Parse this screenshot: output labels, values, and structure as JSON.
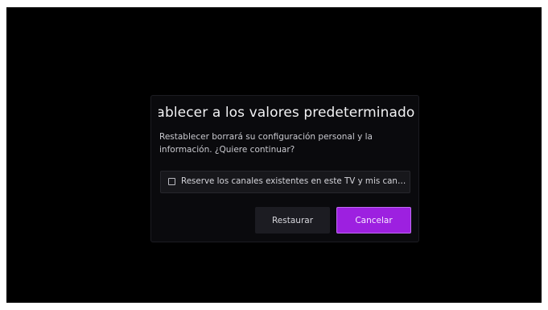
{
  "dialog": {
    "title": "Restablecer a los valores predeterminados de fábrica",
    "message": "Restablecer borrará su configuración personal y la información. ¿Quiere continuar?",
    "checkbox_label": "Reserve los canales existentes en este TV y mis canales",
    "checkbox_checked": false,
    "restore_label": "Restaurar",
    "cancel_label": "Cancelar"
  },
  "colors": {
    "background": "#000000",
    "dialog": "#0a0a0d",
    "accent": "#9d20e0"
  }
}
